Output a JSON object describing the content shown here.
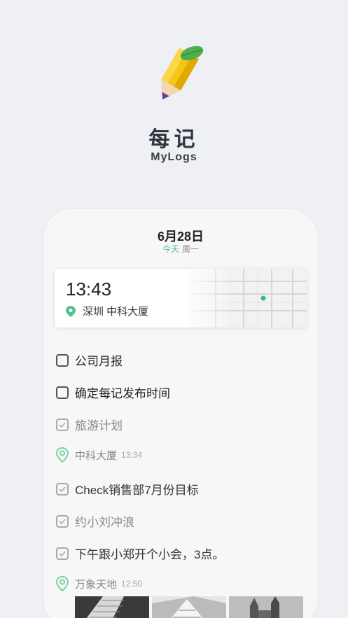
{
  "app": {
    "name": "每记",
    "subtitle": "MyLogs"
  },
  "header": {
    "date": "6月28日",
    "today_label": "今天",
    "weekday": "周一"
  },
  "location_card": {
    "time": "13:43",
    "place": "深圳 中科大厦",
    "pin_color": "#56c18c"
  },
  "entries": [
    {
      "type": "todo",
      "text": "公司月报",
      "done": false
    },
    {
      "type": "todo",
      "text": "确定每记发布时间",
      "done": false
    },
    {
      "type": "todo",
      "text": "旅游计划",
      "done": true
    },
    {
      "type": "location",
      "text": "中科大厦",
      "time": "13:34"
    },
    {
      "type": "todo",
      "text": "Check销售部7月份目标",
      "done": true
    },
    {
      "type": "todo",
      "text": "约小刘冲浪",
      "done": true
    },
    {
      "type": "todo",
      "text": "下午跟小郑开个小会，3点。",
      "done": true
    },
    {
      "type": "location",
      "text": "万象天地",
      "time": "12:50"
    }
  ],
  "photos": [
    "building-photo-1",
    "building-photo-2",
    "building-photo-3"
  ]
}
